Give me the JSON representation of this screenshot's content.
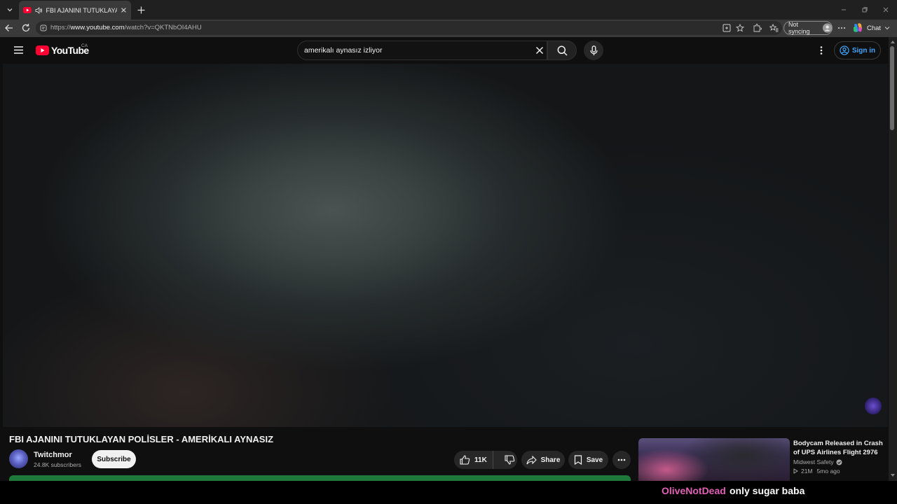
{
  "browser": {
    "tab_title": "FBI AJANINI TUTUKLAYAN POLİSLER",
    "url_prefix": "https://",
    "url_domain": "www.youtube.com",
    "url_path": "/watch?v=QKTNbOI4AHU",
    "sync_label": "Not syncing",
    "chat_label": "Chat"
  },
  "youtube": {
    "logo_text": "YouTube",
    "country_code": "CA",
    "search_query": "amerikalı aynasız izliyor",
    "signin_label": "Sign in"
  },
  "video": {
    "title": "FBI AJANINI TUTUKLAYAN POLİSLER - AMERİKALI AYNASIZ",
    "channel_name": "Twitchmor",
    "subscribers": "24.8K subscribers",
    "subscribe_label": "Subscribe",
    "like_count": "11K",
    "share_label": "Share",
    "save_label": "Save"
  },
  "recommendation": {
    "title": "Bodycam Released in Crash of UPS Airlines Flight 2976",
    "channel": "Midwest Safety",
    "views": "21M",
    "age": "5mo ago"
  },
  "overlay": {
    "username": "OliveNotDead",
    "message": "only sugar baba",
    "username_color": "#e45fb8"
  },
  "colors": {
    "accent_blue": "#3ea6ff",
    "youtube_red": "#ff0033",
    "progress_green": "#1e7a3a"
  }
}
